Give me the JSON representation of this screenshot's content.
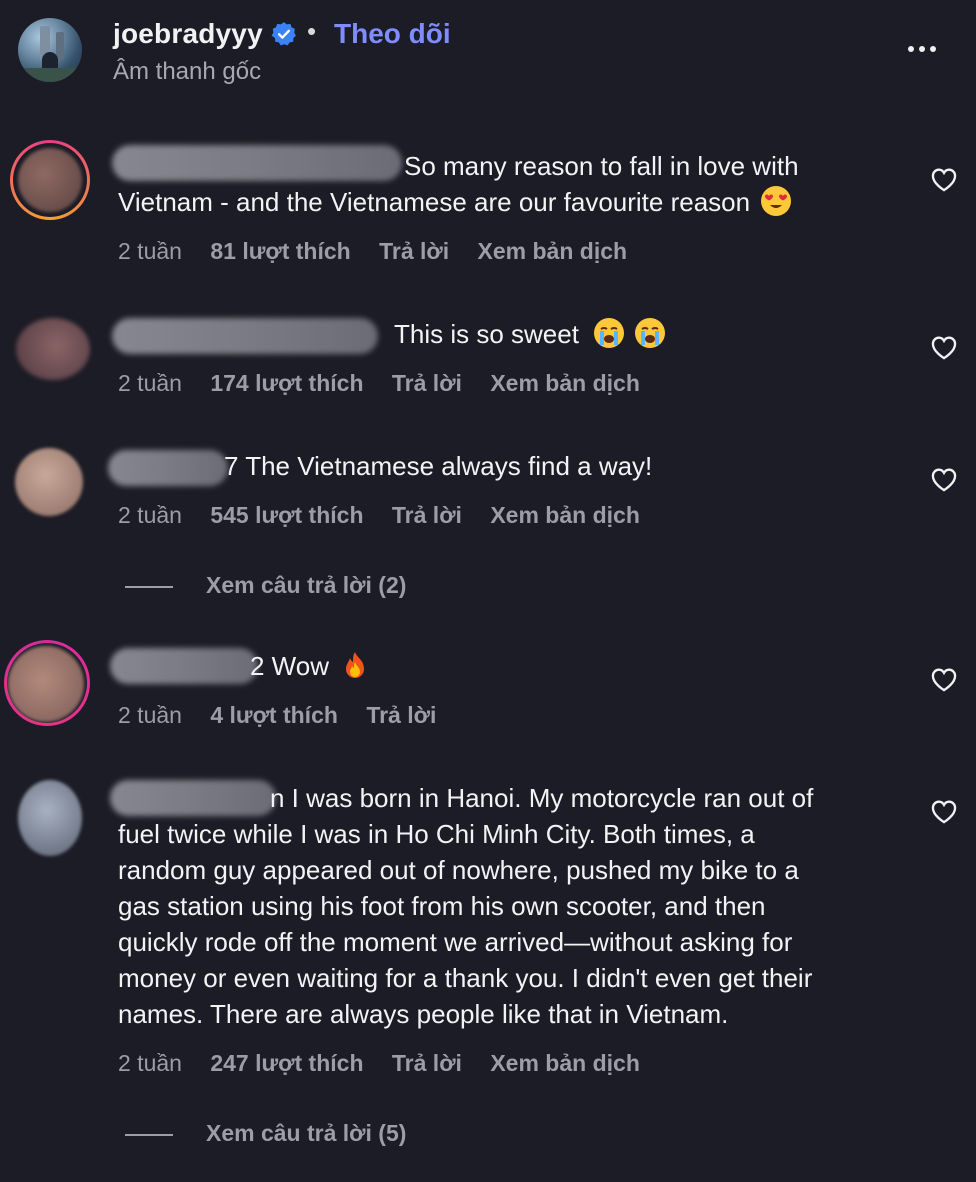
{
  "header": {
    "username": "joebradyyy",
    "separator": "•",
    "follow_label": "Theo dõi",
    "subtitle": "Âm thanh gốc"
  },
  "comments": [
    {
      "text_line1": "So many reason to fall in love with",
      "text_line2": "Vietnam - and the Vietnamese are our favourite reason",
      "time": "2 tuần",
      "likes": "81 lượt thích",
      "reply": "Trả lời",
      "translate": "Xem bản dịch"
    },
    {
      "text": "This is so sweet",
      "time": "2 tuần",
      "likes": "174 lượt thích",
      "reply": "Trả lời",
      "translate": "Xem bản dịch"
    },
    {
      "text": "7 The Vietnamese always find a way!",
      "time": "2 tuần",
      "likes": "545 lượt thích",
      "reply": "Trả lời",
      "translate": "Xem bản dịch",
      "view_replies": "Xem câu trả lời (2)"
    },
    {
      "text": "2 Wow",
      "time": "2 tuần",
      "likes": "4 lượt thích",
      "reply": "Trả lời"
    },
    {
      "lines": [
        "n I was born in Hanoi. My motorcycle ran out of",
        "fuel twice while I was in Ho Chi Minh City. Both times, a",
        "random guy appeared out of nowhere, pushed my bike to a",
        "gas station using his foot from his own scooter, and then",
        "quickly rode off the moment we arrived—without asking for",
        "money or even waiting for a thank you. I didn't even get their",
        "names. There are always people like that in Vietnam."
      ],
      "time": "2 tuần",
      "likes": "247 lượt thích",
      "reply": "Trả lời",
      "translate": "Xem bản dịch",
      "view_replies": "Xem câu trả lời (5)"
    }
  ],
  "icons": {
    "verified": "verified-badge-icon",
    "more": "more-options-icon",
    "heart": "heart-outline-icon"
  },
  "colors": {
    "background": "#1c1c26",
    "follow": "#7d8cff",
    "muted": "#9d9da8",
    "verified": "#3b82f6"
  }
}
